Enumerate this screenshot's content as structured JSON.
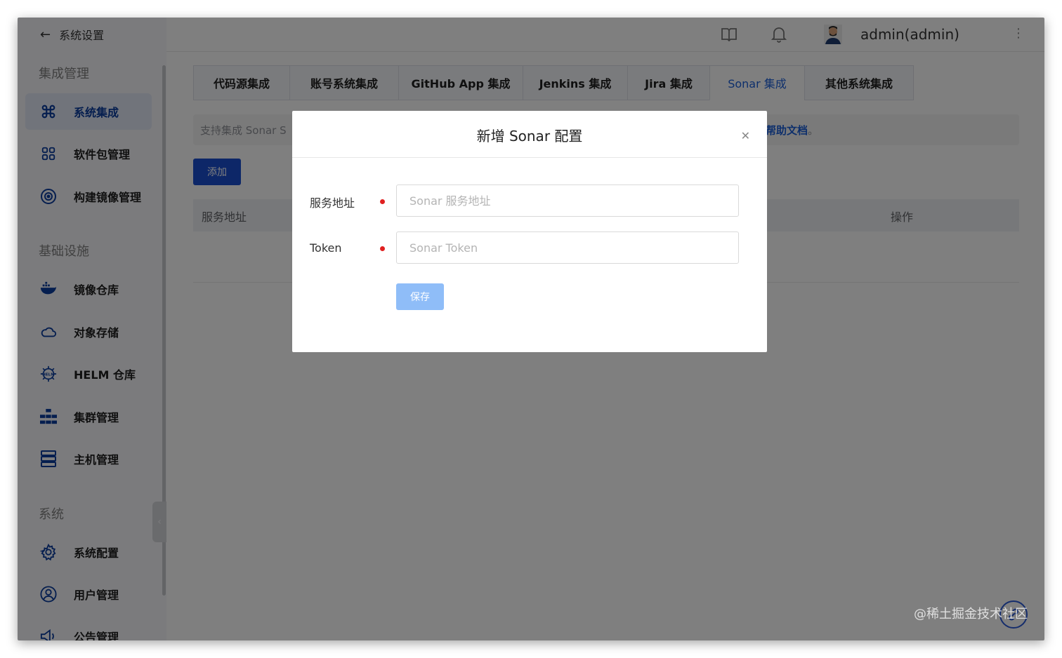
{
  "sidebar": {
    "back_title": "系统设置",
    "groups": [
      "集成管理",
      "基础设施",
      "系统"
    ],
    "items": [
      {
        "label": "系统集成",
        "active": true
      },
      {
        "label": "软件包管理"
      },
      {
        "label": "构建镜像管理"
      },
      {
        "label": "镜像仓库"
      },
      {
        "label": "对象存储"
      },
      {
        "label": "HELM 仓库"
      },
      {
        "label": "集群管理"
      },
      {
        "label": "主机管理"
      },
      {
        "label": "系统配置"
      },
      {
        "label": "用户管理"
      },
      {
        "label": "公告管理"
      }
    ]
  },
  "topbar": {
    "username": "admin(admin)"
  },
  "tabs": [
    "代码源集成",
    "账号系统集成",
    "GitHub App 集成",
    "Jenkins 集成",
    "Jira 集成",
    "Sonar 集成",
    "其他系统集成"
  ],
  "active_tab": "Sonar 集成",
  "notice": {
    "text_visible": "支持集成 Sonar S",
    "doc_link": "帮助文档",
    "tail": "。"
  },
  "add_button": "添加",
  "table": {
    "headers": [
      "服务地址",
      "操作"
    ]
  },
  "dialog": {
    "title": "新增 Sonar 配置",
    "fields": [
      {
        "label": "服务地址",
        "placeholder": "Sonar 服务地址",
        "value": ""
      },
      {
        "label": "Token",
        "placeholder": "Sonar Token",
        "value": ""
      }
    ],
    "save_label": "保存"
  },
  "watermark": "@稀土掘金技术社区",
  "colors": {
    "accent": "#1a5fd8",
    "required": "#e02020",
    "save_disabled": "#8fbdf8",
    "add_button": "#1a4ed0"
  }
}
